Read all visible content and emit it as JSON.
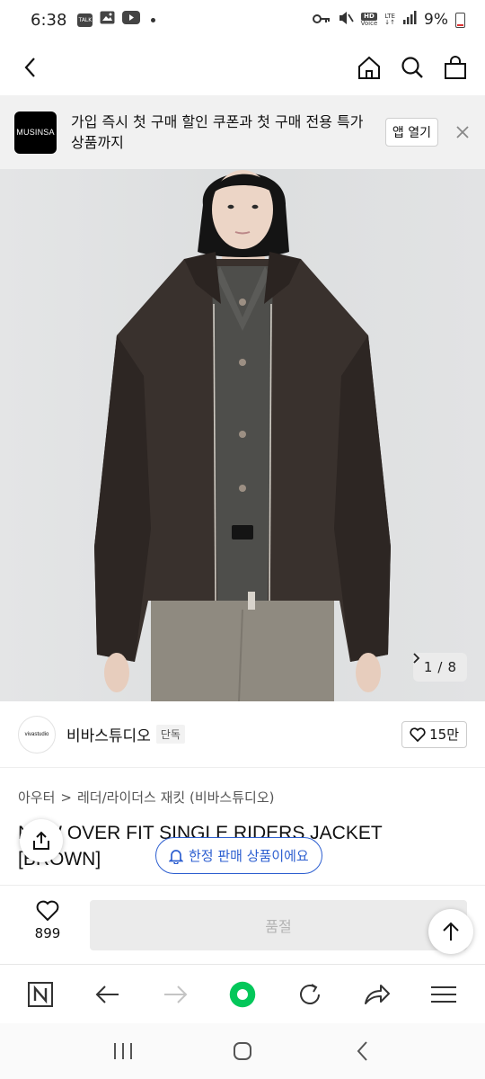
{
  "status_bar": {
    "time": "6:38",
    "notif_talk": "TALK",
    "net_hd": "HD",
    "net_voice": "Voice",
    "net_lte": "LTE",
    "battery": "9%"
  },
  "header": {
    "back_icon": "chevron-left-icon",
    "home_icon": "home-icon",
    "search_icon": "search-icon",
    "cart_icon": "shopping-bag-icon"
  },
  "promo": {
    "logo_text": "MUSINSA",
    "text": "가입 즉시 첫 구매 할인 쿠폰과 첫 구매 전용 특가 상품까지",
    "open_label": "앱 열기"
  },
  "gallery": {
    "current": "1",
    "separator": "/",
    "total": "8"
  },
  "brand": {
    "logo_text": "vivastudio",
    "name": "비바스튜디오",
    "tag": "단독",
    "likes": "15만"
  },
  "breadcrumb": {
    "category": "아우터",
    "separator": ">",
    "subcategory": "레더/라이더스 재킷 (비바스튜디오)"
  },
  "product": {
    "title": "NEW OVER FIT SINGLE RIDERS JACKET [BROWN]",
    "limited_notice": "한정 판매 상품이에요"
  },
  "purchase_bar": {
    "wish_count": "899",
    "soldout_label": "품절"
  },
  "colors": {
    "accent_blue": "#2d5fd0",
    "naver_green": "#03c75a",
    "promo_bg": "#f1f1f1"
  }
}
